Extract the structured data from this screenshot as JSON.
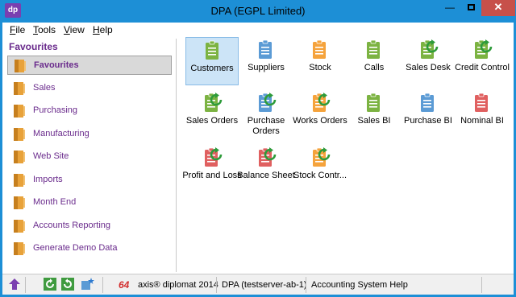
{
  "window": {
    "app_icon_text": "dp",
    "title": "DPA (EGPL Limited)",
    "controls": {
      "minimize": "—",
      "close": "✕"
    }
  },
  "menu": [
    {
      "label": "File",
      "accel": "F",
      "rest": "ile"
    },
    {
      "label": "Tools",
      "accel": "T",
      "rest": "ools"
    },
    {
      "label": "View",
      "accel": "V",
      "rest": "iew"
    },
    {
      "label": "Help",
      "accel": "H",
      "rest": "elp"
    }
  ],
  "sidebar": {
    "header": "Favourites",
    "selected_index": 0,
    "items": [
      {
        "label": "Favourites"
      },
      {
        "label": "Sales"
      },
      {
        "label": "Purchasing"
      },
      {
        "label": "Manufacturing"
      },
      {
        "label": "Web Site"
      },
      {
        "label": "Imports"
      },
      {
        "label": "Month End"
      },
      {
        "label": "Accounts Reporting"
      },
      {
        "label": "Generate Demo Data"
      }
    ]
  },
  "tiles": [
    {
      "label": "Customers",
      "icon": "clipboard-icon",
      "color": "#7cb342",
      "refresh": false,
      "selected": true
    },
    {
      "label": "Suppliers",
      "icon": "clipboard-icon",
      "color": "#5b9bd5",
      "refresh": false
    },
    {
      "label": "Stock",
      "icon": "clipboard-icon",
      "color": "#f5a33c",
      "refresh": false
    },
    {
      "label": "Calls",
      "icon": "clipboard-icon",
      "color": "#7cb342",
      "refresh": false
    },
    {
      "label": "Sales Desk",
      "icon": "clipboard-refresh-icon",
      "color": "#7cb342",
      "refresh": true
    },
    {
      "label": "Credit Control",
      "icon": "clipboard-refresh-icon",
      "color": "#7cb342",
      "refresh": true
    },
    {
      "label": "Sales Orders",
      "icon": "clipboard-refresh-icon",
      "color": "#7cb342",
      "refresh": true
    },
    {
      "label": "Purchase Orders",
      "icon": "clipboard-refresh-icon",
      "color": "#5b9bd5",
      "refresh": true
    },
    {
      "label": "Works Orders",
      "icon": "clipboard-refresh-icon",
      "color": "#f5a33c",
      "refresh": true
    },
    {
      "label": "Sales BI",
      "icon": "clipboard-icon",
      "color": "#7cb342",
      "refresh": false
    },
    {
      "label": "Purchase BI",
      "icon": "clipboard-icon",
      "color": "#5b9bd5",
      "refresh": false
    },
    {
      "label": "Nominal BI",
      "icon": "clipboard-icon",
      "color": "#e06060",
      "refresh": false
    },
    {
      "label": "Profit and Loss",
      "icon": "clipboard-refresh-icon",
      "color": "#e06060",
      "refresh": true
    },
    {
      "label": "Balance Sheet",
      "icon": "clipboard-refresh-icon",
      "color": "#e06060",
      "refresh": true
    },
    {
      "label": "Stock Contr...",
      "icon": "clipboard-refresh-icon",
      "color": "#f5a33c",
      "refresh": true
    }
  ],
  "statusbar": {
    "badge": "64",
    "product": "axis® diplomat 2014",
    "server": "DPA (testserver-ab-1)",
    "help": "Accounting System Help"
  },
  "colors": {
    "titlebar": "#1d8fd6",
    "accent_purple": "#6a2b8c",
    "folder": "#e8a23a",
    "close": "#c7504a"
  }
}
